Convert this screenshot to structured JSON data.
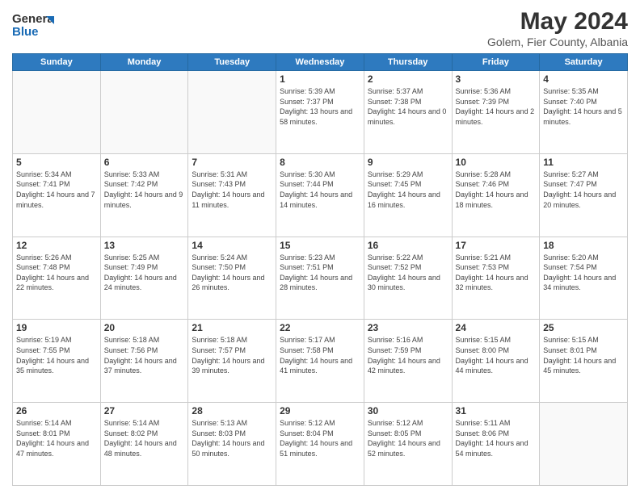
{
  "header": {
    "logo_general": "General",
    "logo_blue": "Blue",
    "month_year": "May 2024",
    "location": "Golem, Fier County, Albania"
  },
  "weekdays": [
    "Sunday",
    "Monday",
    "Tuesday",
    "Wednesday",
    "Thursday",
    "Friday",
    "Saturday"
  ],
  "weeks": [
    [
      {
        "day": "",
        "sunrise": "",
        "sunset": "",
        "daylight": ""
      },
      {
        "day": "",
        "sunrise": "",
        "sunset": "",
        "daylight": ""
      },
      {
        "day": "",
        "sunrise": "",
        "sunset": "",
        "daylight": ""
      },
      {
        "day": "1",
        "sunrise": "Sunrise: 5:39 AM",
        "sunset": "Sunset: 7:37 PM",
        "daylight": "Daylight: 13 hours and 58 minutes."
      },
      {
        "day": "2",
        "sunrise": "Sunrise: 5:37 AM",
        "sunset": "Sunset: 7:38 PM",
        "daylight": "Daylight: 14 hours and 0 minutes."
      },
      {
        "day": "3",
        "sunrise": "Sunrise: 5:36 AM",
        "sunset": "Sunset: 7:39 PM",
        "daylight": "Daylight: 14 hours and 2 minutes."
      },
      {
        "day": "4",
        "sunrise": "Sunrise: 5:35 AM",
        "sunset": "Sunset: 7:40 PM",
        "daylight": "Daylight: 14 hours and 5 minutes."
      }
    ],
    [
      {
        "day": "5",
        "sunrise": "Sunrise: 5:34 AM",
        "sunset": "Sunset: 7:41 PM",
        "daylight": "Daylight: 14 hours and 7 minutes."
      },
      {
        "day": "6",
        "sunrise": "Sunrise: 5:33 AM",
        "sunset": "Sunset: 7:42 PM",
        "daylight": "Daylight: 14 hours and 9 minutes."
      },
      {
        "day": "7",
        "sunrise": "Sunrise: 5:31 AM",
        "sunset": "Sunset: 7:43 PM",
        "daylight": "Daylight: 14 hours and 11 minutes."
      },
      {
        "day": "8",
        "sunrise": "Sunrise: 5:30 AM",
        "sunset": "Sunset: 7:44 PM",
        "daylight": "Daylight: 14 hours and 14 minutes."
      },
      {
        "day": "9",
        "sunrise": "Sunrise: 5:29 AM",
        "sunset": "Sunset: 7:45 PM",
        "daylight": "Daylight: 14 hours and 16 minutes."
      },
      {
        "day": "10",
        "sunrise": "Sunrise: 5:28 AM",
        "sunset": "Sunset: 7:46 PM",
        "daylight": "Daylight: 14 hours and 18 minutes."
      },
      {
        "day": "11",
        "sunrise": "Sunrise: 5:27 AM",
        "sunset": "Sunset: 7:47 PM",
        "daylight": "Daylight: 14 hours and 20 minutes."
      }
    ],
    [
      {
        "day": "12",
        "sunrise": "Sunrise: 5:26 AM",
        "sunset": "Sunset: 7:48 PM",
        "daylight": "Daylight: 14 hours and 22 minutes."
      },
      {
        "day": "13",
        "sunrise": "Sunrise: 5:25 AM",
        "sunset": "Sunset: 7:49 PM",
        "daylight": "Daylight: 14 hours and 24 minutes."
      },
      {
        "day": "14",
        "sunrise": "Sunrise: 5:24 AM",
        "sunset": "Sunset: 7:50 PM",
        "daylight": "Daylight: 14 hours and 26 minutes."
      },
      {
        "day": "15",
        "sunrise": "Sunrise: 5:23 AM",
        "sunset": "Sunset: 7:51 PM",
        "daylight": "Daylight: 14 hours and 28 minutes."
      },
      {
        "day": "16",
        "sunrise": "Sunrise: 5:22 AM",
        "sunset": "Sunset: 7:52 PM",
        "daylight": "Daylight: 14 hours and 30 minutes."
      },
      {
        "day": "17",
        "sunrise": "Sunrise: 5:21 AM",
        "sunset": "Sunset: 7:53 PM",
        "daylight": "Daylight: 14 hours and 32 minutes."
      },
      {
        "day": "18",
        "sunrise": "Sunrise: 5:20 AM",
        "sunset": "Sunset: 7:54 PM",
        "daylight": "Daylight: 14 hours and 34 minutes."
      }
    ],
    [
      {
        "day": "19",
        "sunrise": "Sunrise: 5:19 AM",
        "sunset": "Sunset: 7:55 PM",
        "daylight": "Daylight: 14 hours and 35 minutes."
      },
      {
        "day": "20",
        "sunrise": "Sunrise: 5:18 AM",
        "sunset": "Sunset: 7:56 PM",
        "daylight": "Daylight: 14 hours and 37 minutes."
      },
      {
        "day": "21",
        "sunrise": "Sunrise: 5:18 AM",
        "sunset": "Sunset: 7:57 PM",
        "daylight": "Daylight: 14 hours and 39 minutes."
      },
      {
        "day": "22",
        "sunrise": "Sunrise: 5:17 AM",
        "sunset": "Sunset: 7:58 PM",
        "daylight": "Daylight: 14 hours and 41 minutes."
      },
      {
        "day": "23",
        "sunrise": "Sunrise: 5:16 AM",
        "sunset": "Sunset: 7:59 PM",
        "daylight": "Daylight: 14 hours and 42 minutes."
      },
      {
        "day": "24",
        "sunrise": "Sunrise: 5:15 AM",
        "sunset": "Sunset: 8:00 PM",
        "daylight": "Daylight: 14 hours and 44 minutes."
      },
      {
        "day": "25",
        "sunrise": "Sunrise: 5:15 AM",
        "sunset": "Sunset: 8:01 PM",
        "daylight": "Daylight: 14 hours and 45 minutes."
      }
    ],
    [
      {
        "day": "26",
        "sunrise": "Sunrise: 5:14 AM",
        "sunset": "Sunset: 8:01 PM",
        "daylight": "Daylight: 14 hours and 47 minutes."
      },
      {
        "day": "27",
        "sunrise": "Sunrise: 5:14 AM",
        "sunset": "Sunset: 8:02 PM",
        "daylight": "Daylight: 14 hours and 48 minutes."
      },
      {
        "day": "28",
        "sunrise": "Sunrise: 5:13 AM",
        "sunset": "Sunset: 8:03 PM",
        "daylight": "Daylight: 14 hours and 50 minutes."
      },
      {
        "day": "29",
        "sunrise": "Sunrise: 5:12 AM",
        "sunset": "Sunset: 8:04 PM",
        "daylight": "Daylight: 14 hours and 51 minutes."
      },
      {
        "day": "30",
        "sunrise": "Sunrise: 5:12 AM",
        "sunset": "Sunset: 8:05 PM",
        "daylight": "Daylight: 14 hours and 52 minutes."
      },
      {
        "day": "31",
        "sunrise": "Sunrise: 5:11 AM",
        "sunset": "Sunset: 8:06 PM",
        "daylight": "Daylight: 14 hours and 54 minutes."
      },
      {
        "day": "",
        "sunrise": "",
        "sunset": "",
        "daylight": ""
      }
    ]
  ]
}
